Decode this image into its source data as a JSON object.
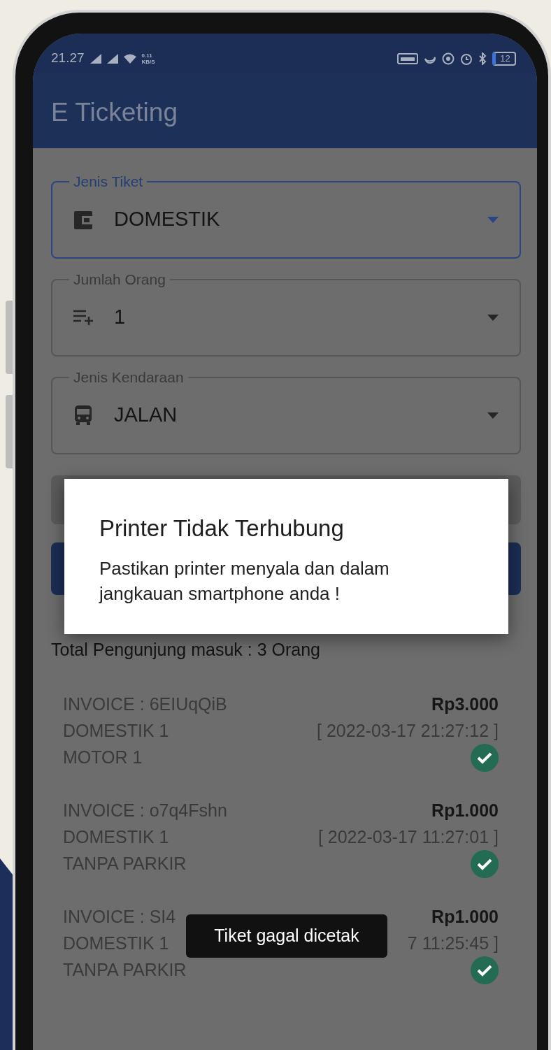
{
  "status_bar": {
    "time": "21.27",
    "speed": [
      "0.11",
      "KB/S"
    ],
    "battery": "12"
  },
  "app_bar": {
    "title": "E Ticketing"
  },
  "fields": [
    {
      "label": "Jenis Tiket",
      "value": "DOMESTIK",
      "kind": "wallet",
      "focused": true
    },
    {
      "label": "Jumlah Orang",
      "value": "1",
      "kind": "list-add",
      "focused": false
    },
    {
      "label": "Jenis Kendaraan",
      "value": "JALAN",
      "kind": "bus",
      "focused": false
    }
  ],
  "summary": "Total Pengunjung masuk : 3 Orang",
  "entries": [
    {
      "invoice": "INVOICE : 6EIUqQiB",
      "amount": "Rp3.000",
      "ticket": "DOMESTIK 1",
      "datetime": "[ 2022-03-17 21:27:12 ]",
      "vehicle": "MOTOR 1",
      "done": true
    },
    {
      "invoice": "INVOICE : o7q4Fshn",
      "amount": "Rp1.000",
      "ticket": "DOMESTIK 1",
      "datetime": "[ 2022-03-17 11:27:01 ]",
      "vehicle": "TANPA PARKIR",
      "done": true
    },
    {
      "invoice": "INVOICE : SI4",
      "amount": "Rp1.000",
      "ticket": "DOMESTIK 1",
      "datetime": "7 11:25:45 ]",
      "vehicle": "TANPA PARKIR",
      "done": true
    }
  ],
  "dialog": {
    "title": "Printer Tidak Terhubung",
    "message": "Pastikan printer menyala dan dalam jangkauan smartphone anda !"
  },
  "toast": "Tiket gagal dicetak"
}
